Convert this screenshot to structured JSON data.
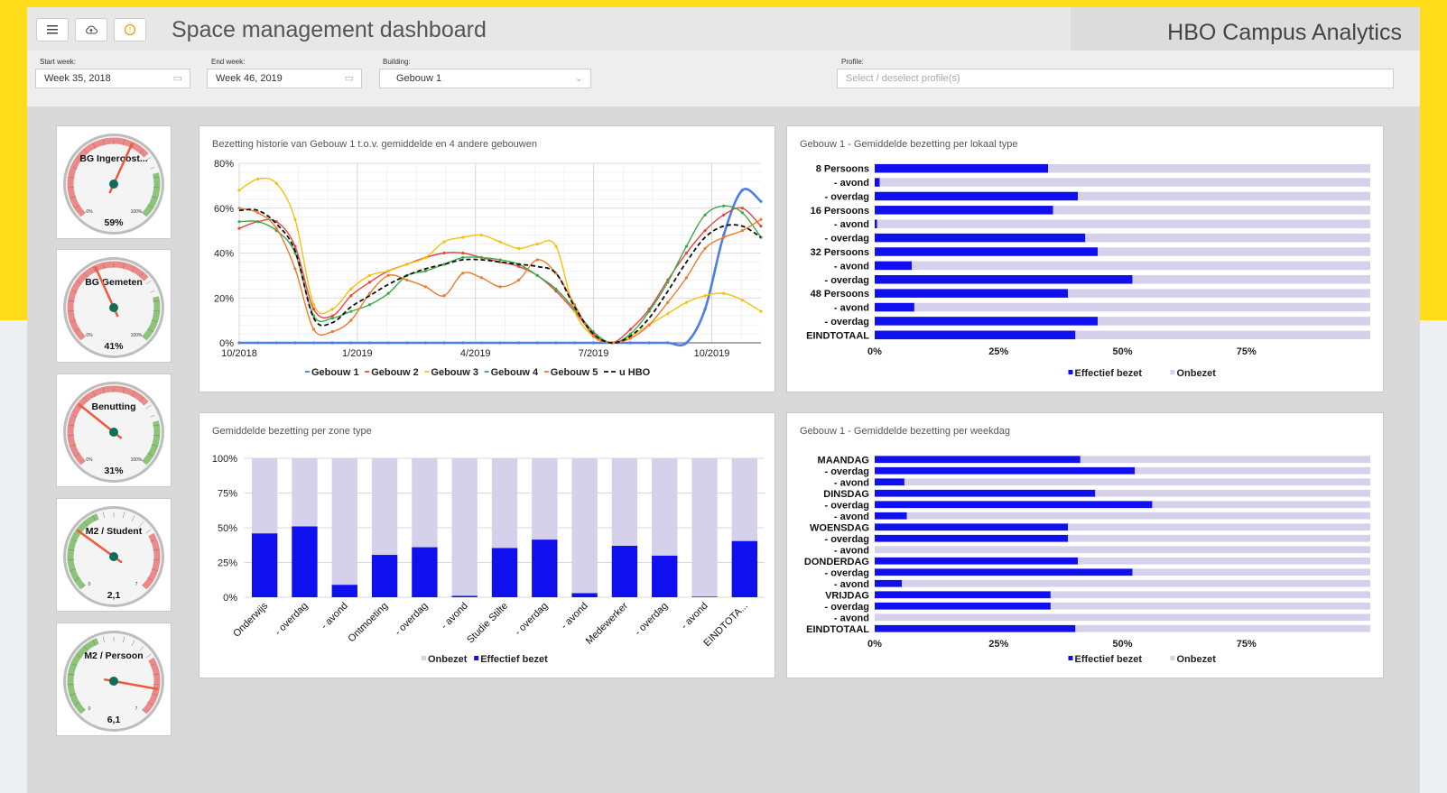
{
  "header": {
    "title": "Space management dashboard",
    "brand": "HBO Campus Analytics",
    "warning_glyph": "!"
  },
  "filters": {
    "start_label": "Start week:",
    "start_value": "Week 35, 2018",
    "end_label": "End week:",
    "end_value": "Week 46, 2019",
    "building_label": "Building:",
    "building_value": "Gebouw 1",
    "profile_label": "Profile:",
    "profile_placeholder": "Select / deselect profile(s)"
  },
  "gauges": [
    {
      "title": "BG Ingeroost...",
      "value_text": "59%",
      "min": "0%",
      "max": "100%",
      "value": 59,
      "range": [
        0,
        100
      ],
      "bands": "red-green"
    },
    {
      "title": "BG Gemeten",
      "value_text": "41%",
      "min": "0%",
      "max": "100%",
      "value": 41,
      "range": [
        0,
        100
      ],
      "bands": "red-green"
    },
    {
      "title": "Benutting",
      "value_text": "31%",
      "min": "0%",
      "max": "100%",
      "value": 31,
      "range": [
        0,
        100
      ],
      "bands": "red-green"
    },
    {
      "title": "M2 / Student",
      "value_text": "2,1",
      "min": "0",
      "max": "7",
      "value": 2.1,
      "range": [
        0,
        7
      ],
      "bands": "green-red"
    },
    {
      "title": "M2 / Persoon",
      "value_text": "6,1",
      "min": "0",
      "max": "7",
      "value": 6.1,
      "range": [
        0,
        7
      ],
      "bands": "green-red"
    }
  ],
  "colors": {
    "effectief": "#1010ee",
    "onbezet": "#d6d1ea",
    "gauge_red": "#ec8a8a",
    "gauge_green": "#8cc47a",
    "needle": "#f05a3c",
    "hub": "#0f6e5a"
  },
  "chart_data": [
    {
      "type": "line",
      "title": "Bezetting historie van Gebouw 1 t.o.v. gemiddelde en 4 andere gebouwen",
      "x": [
        0,
        1,
        2,
        3,
        4,
        5,
        6,
        7,
        8,
        9,
        10,
        11,
        12,
        13,
        14,
        15,
        16,
        17,
        18,
        19,
        20,
        21,
        22,
        23,
        24
      ],
      "xticks": [
        {
          "pos": 0,
          "label": "10/2018"
        },
        {
          "pos": 6,
          "label": "1/2019"
        },
        {
          "pos": 12,
          "label": "4/2019"
        },
        {
          "pos": 18,
          "label": "7/2019"
        },
        {
          "pos": 24,
          "label": "10/2019"
        }
      ],
      "yticks": [
        "0%",
        "20%",
        "40%",
        "60%",
        "80%"
      ],
      "ylim": [
        0,
        80
      ],
      "xlim": [
        0,
        26.5
      ],
      "grid": true,
      "legend": "bottom",
      "series": [
        {
          "name": "Gebouw 1",
          "color": "#4a7ee8",
          "width": 2.6,
          "dash": "",
          "values": [
            0,
            0,
            0,
            0,
            0,
            0,
            0,
            0,
            0,
            0,
            0,
            0,
            0,
            0,
            0,
            0,
            0,
            0,
            0,
            0,
            0,
            0,
            0,
            0,
            0,
            15,
            48,
            68,
            63
          ]
        },
        {
          "name": "Gebouw 2",
          "color": "#e8453c",
          "width": 1.4,
          "dash": "",
          "values": [
            51,
            54,
            54,
            43,
            15,
            12,
            21,
            27,
            32,
            35,
            38,
            40,
            40,
            38,
            36,
            34,
            30,
            23,
            14,
            4,
            0,
            6,
            15,
            28,
            40,
            50,
            57,
            60,
            52
          ]
        },
        {
          "name": "Gebouw 3",
          "color": "#f4c20d",
          "width": 1.4,
          "dash": "",
          "values": [
            68,
            73,
            71,
            55,
            17,
            15,
            24,
            30,
            32,
            35,
            38,
            45,
            47,
            48,
            45,
            42,
            44,
            43,
            14,
            3,
            0,
            3,
            8,
            13,
            18,
            21,
            22,
            19,
            14
          ]
        },
        {
          "name": "Gebouw 4",
          "color": "#3cab4a",
          "width": 1.4,
          "dash": "",
          "values": [
            54,
            54,
            50,
            40,
            12,
            11,
            14,
            17,
            22,
            30,
            32,
            35,
            38,
            38,
            37,
            35,
            30,
            24,
            15,
            5,
            0,
            4,
            14,
            27,
            43,
            57,
            61,
            58,
            47
          ]
        },
        {
          "name": "Gebouw 5",
          "color": "#f07a2a",
          "width": 1.4,
          "dash": "",
          "values": [
            60,
            58,
            51,
            33,
            6,
            5,
            10,
            22,
            30,
            28,
            25,
            21,
            31,
            29,
            25,
            28,
            37,
            31,
            17,
            3,
            0,
            2,
            8,
            18,
            29,
            42,
            47,
            50,
            55
          ]
        },
        {
          "name": "u HBO",
          "color": "#111111",
          "width": 1.8,
          "dash": "5,3",
          "values": [
            59,
            59,
            53,
            41,
            11,
            9,
            16,
            21,
            26,
            30,
            33,
            35,
            37,
            37,
            36,
            35,
            34,
            31,
            16,
            4,
            0,
            3,
            11,
            23,
            36,
            47,
            52,
            52,
            47
          ]
        }
      ]
    },
    {
      "type": "bar",
      "orientation": "horizontal",
      "stacked": true,
      "title": "Gebouw 1 - Gemiddelde bezetting per lokaal type",
      "categories": [
        "8 Persoons",
        "- avond",
        "- overdag",
        "16 Persoons",
        "- avond",
        "- overdag",
        "32 Persoons",
        "- avond",
        "- overdag",
        "48 Persoons",
        "- avond",
        "- overdag",
        "EINDTOTAAL"
      ],
      "series": [
        {
          "name": "Effectief bezet",
          "values": [
            35,
            1,
            41,
            36,
            0.5,
            42.5,
            45,
            7.5,
            52,
            39,
            8,
            45,
            40.5
          ]
        },
        {
          "name": "Onbezet",
          "values": [
            65,
            99,
            59,
            64,
            99.5,
            57.5,
            55,
            92.5,
            48,
            61,
            92,
            55,
            59.5
          ]
        }
      ],
      "xticks": [
        "0%",
        "25%",
        "50%",
        "75%"
      ],
      "xlim": [
        0,
        100
      ],
      "legend": "bottom"
    },
    {
      "type": "bar",
      "stacked": true,
      "title": "Gemiddelde bezetting per zone type",
      "categories": [
        "Onderwijs",
        "- overdag",
        "- avond",
        "Ontmoeting",
        "- overdag",
        "- avond",
        "Studie Stilte",
        "- overdag",
        "- avond",
        "Medewerker",
        "- overdag",
        "- avond",
        "EINDTOTA..."
      ],
      "series": [
        {
          "name": "Onbezet",
          "values": [
            54,
            49,
            91,
            69.5,
            64,
            99,
            64.5,
            58.5,
            97,
            63,
            70,
            99.5,
            59.5
          ]
        },
        {
          "name": "Effectief bezet",
          "values": [
            46,
            51,
            9,
            30.5,
            36,
            1,
            35.5,
            41.5,
            3,
            37,
            30,
            0.5,
            40.5
          ]
        }
      ],
      "yticks": [
        "0%",
        "25%",
        "50%",
        "75%",
        "100%"
      ],
      "ylim": [
        0,
        100
      ],
      "legend": "bottom"
    },
    {
      "type": "bar",
      "orientation": "horizontal",
      "stacked": true,
      "title": "Gebouw 1 - Gemiddelde bezetting per weekdag",
      "categories": [
        "MAANDAG",
        "- overdag",
        "- avond",
        "DINSDAG",
        "- overdag",
        "- avond",
        "WOENSDAG",
        "- overdag",
        "- avond",
        "DONDERDAG",
        "- overdag",
        "- avond",
        "VRIJDAG",
        "- overdag",
        "- avond",
        "EINDTOTAAL"
      ],
      "series": [
        {
          "name": "Effectief bezet",
          "values": [
            41.5,
            52.5,
            6,
            44.5,
            56,
            6.5,
            39,
            39,
            0,
            41,
            52,
            5.5,
            35.5,
            35.5,
            0,
            40.5
          ]
        },
        {
          "name": "Onbezet",
          "values": [
            58.5,
            47.5,
            94,
            55.5,
            44,
            93.5,
            61,
            61,
            100,
            59,
            48,
            94.5,
            64.5,
            64.5,
            100,
            59.5
          ]
        }
      ],
      "xticks": [
        "0%",
        "25%",
        "50%",
        "75%"
      ],
      "xlim": [
        0,
        100
      ],
      "legend": "bottom"
    }
  ]
}
